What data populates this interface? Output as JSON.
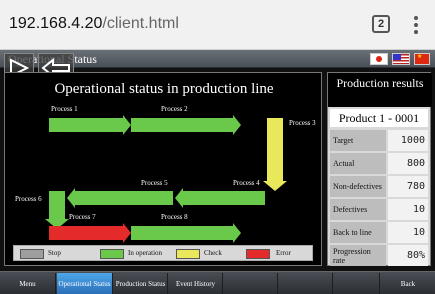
{
  "browser": {
    "url_host": "192.168.4.20",
    "url_path": "/client.html",
    "tab_count": "2"
  },
  "app": {
    "title": "Operational Status",
    "main_title": "Operational status in production line",
    "processes": [
      {
        "label": "Process 1",
        "status": "in-operation"
      },
      {
        "label": "Process 2",
        "status": "in-operation"
      },
      {
        "label": "Process 3",
        "status": "check"
      },
      {
        "label": "Process 4",
        "status": "in-operation"
      },
      {
        "label": "Process 5",
        "status": "in-operation"
      },
      {
        "label": "Process 6",
        "status": "in-operation"
      },
      {
        "label": "Process 7",
        "status": "error"
      },
      {
        "label": "Process 8",
        "status": "in-operation"
      }
    ],
    "legend": [
      {
        "label": "Stop",
        "color": "#9e9e9e"
      },
      {
        "label": "In operation",
        "color": "#6ac84a"
      },
      {
        "label": "Check",
        "color": "#e8e85a"
      },
      {
        "label": "Error",
        "color": "#e52a2a"
      }
    ],
    "results": {
      "header": "Production results",
      "product": "Product 1 - 0001",
      "rows": [
        {
          "label": "Target",
          "value": "1000"
        },
        {
          "label": "Actual",
          "value": "800"
        },
        {
          "label": "Non-defectives",
          "value": "780"
        },
        {
          "label": "Defectives",
          "value": "10"
        },
        {
          "label": "Back to line",
          "value": "10"
        },
        {
          "label": "Progression rate",
          "value": "80%"
        }
      ]
    },
    "bottom_nav": [
      {
        "label": "Menu"
      },
      {
        "label": "Operational Status",
        "active": true
      },
      {
        "label": "Production Status"
      },
      {
        "label": "Event History"
      },
      {
        "label": "Back"
      }
    ],
    "flags": [
      "japan-flag",
      "usa-flag",
      "china-flag"
    ]
  }
}
